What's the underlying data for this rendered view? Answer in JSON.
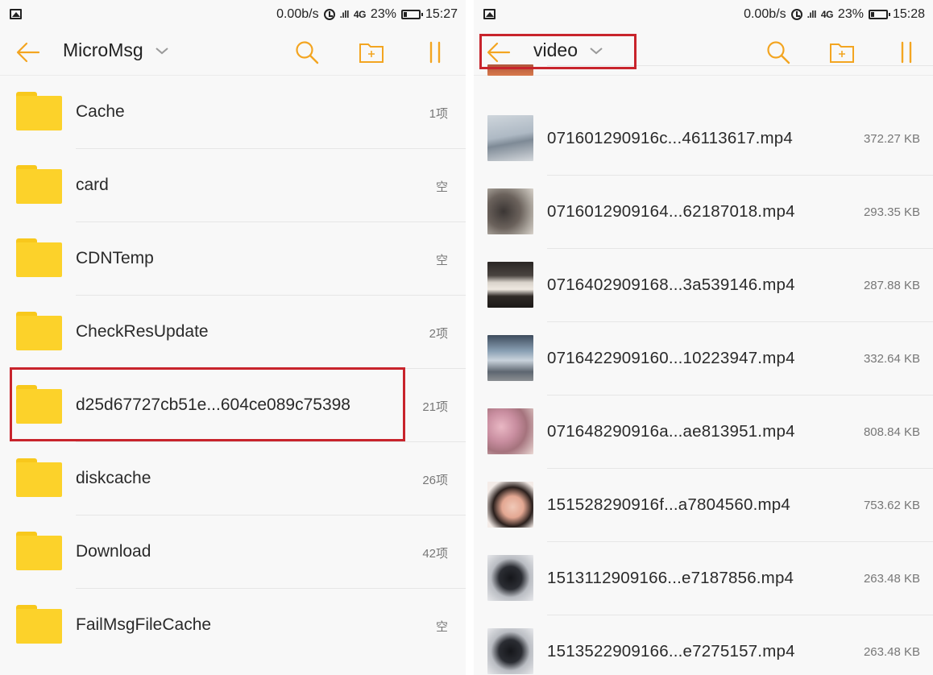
{
  "colors": {
    "accent": "#f3a521",
    "folder": "#fcd22a",
    "highlight": "#c8242c"
  },
  "left": {
    "status": {
      "speed": "0.00b/s",
      "net": "4G",
      "battery": "23%",
      "time": "15:27"
    },
    "toolbar": {
      "title": "MicroMsg",
      "icons": [
        "back-arrow-icon",
        "chevron-down-icon",
        "search-icon",
        "new-folder-icon",
        "pause-icon"
      ]
    },
    "folders": [
      {
        "name": "Cache",
        "meta": "1项"
      },
      {
        "name": "card",
        "meta": "空"
      },
      {
        "name": "CDNTemp",
        "meta": "空"
      },
      {
        "name": "CheckResUpdate",
        "meta": "2项"
      },
      {
        "name": "d25d67727cb51e...604ce089c75398",
        "meta": "21项"
      },
      {
        "name": "diskcache",
        "meta": "26项"
      },
      {
        "name": "Download",
        "meta": "42项"
      },
      {
        "name": "FailMsgFileCache",
        "meta": "空"
      }
    ]
  },
  "right": {
    "status": {
      "speed": "0.00b/s",
      "net": "4G",
      "battery": "23%",
      "time": "15:28"
    },
    "toolbar": {
      "title": "video",
      "icons": [
        "back-arrow-icon",
        "chevron-down-icon",
        "search-icon",
        "new-folder-icon",
        "pause-icon"
      ]
    },
    "files": [
      {
        "name": "071601290916c...46113617.mp4",
        "size": "372.27 KB"
      },
      {
        "name": "0716012909164...62187018.mp4",
        "size": "293.35 KB"
      },
      {
        "name": "0716402909168...3a539146.mp4",
        "size": "287.88 KB"
      },
      {
        "name": "0716422909160...10223947.mp4",
        "size": "332.64 KB"
      },
      {
        "name": "071648290916a...ae813951.mp4",
        "size": "808.84 KB"
      },
      {
        "name": "151528290916f...a7804560.mp4",
        "size": "753.62 KB"
      },
      {
        "name": "1513112909166...e7187856.mp4",
        "size": "263.48 KB"
      },
      {
        "name": "1513522909166...e7275157.mp4",
        "size": "263.48 KB"
      }
    ]
  }
}
